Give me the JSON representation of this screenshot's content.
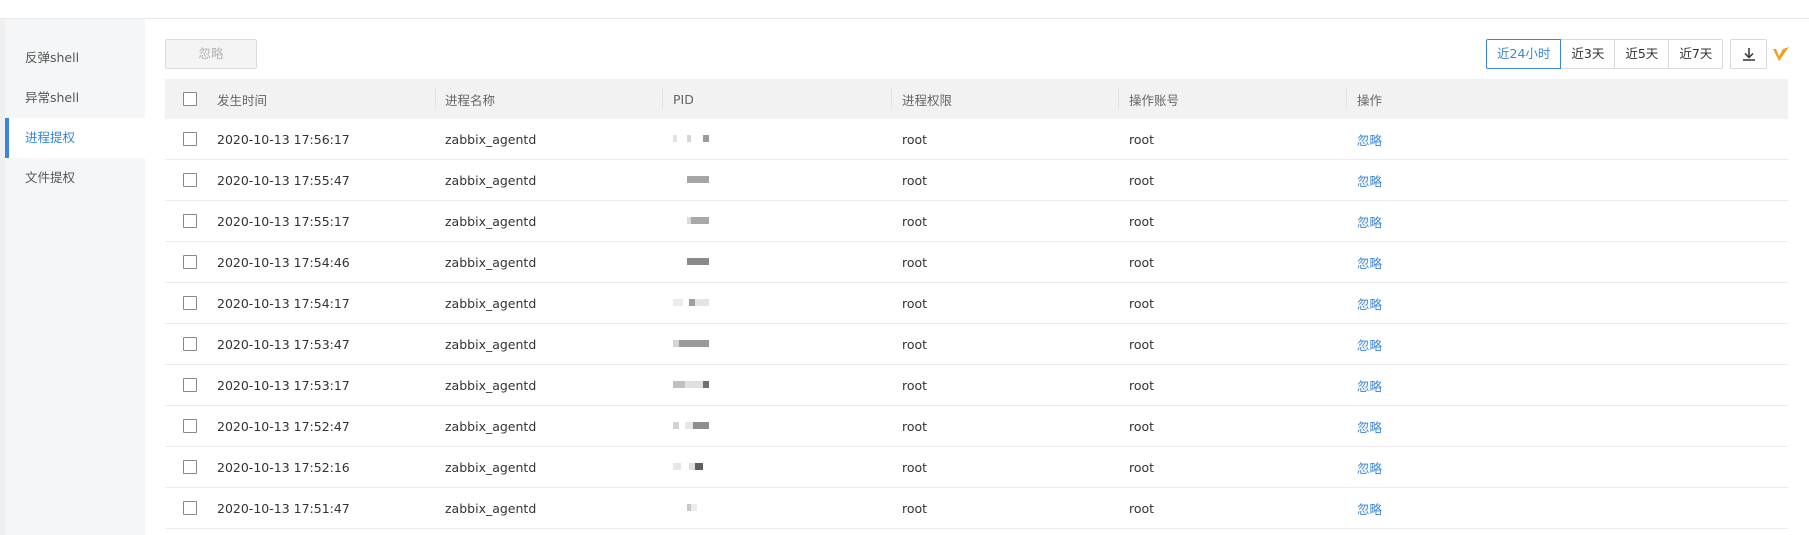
{
  "sidebar": {
    "items": [
      {
        "label": "反弹shell",
        "active": false
      },
      {
        "label": "异常shell",
        "active": false
      },
      {
        "label": "进程提权",
        "active": true
      },
      {
        "label": "文件提权",
        "active": false
      }
    ]
  },
  "toolbar": {
    "ignore_label": "忽略",
    "ranges": [
      {
        "label": "近24小时",
        "active": true
      },
      {
        "label": "近3天",
        "active": false
      },
      {
        "label": "近5天",
        "active": false
      },
      {
        "label": "近7天",
        "active": false
      }
    ],
    "download_icon": "download-icon",
    "brand_icon": "brand-logo-icon"
  },
  "table": {
    "headers": [
      "发生时间",
      "进程名称",
      "PID",
      "进程权限",
      "操作账号",
      "操作"
    ],
    "rows": [
      {
        "time": "2020-10-13 17:56:17",
        "process": "zabbix_agentd",
        "perm": "root",
        "account": "root",
        "action": "忽略"
      },
      {
        "time": "2020-10-13 17:55:47",
        "process": "zabbix_agentd",
        "perm": "root",
        "account": "root",
        "action": "忽略"
      },
      {
        "time": "2020-10-13 17:55:17",
        "process": "zabbix_agentd",
        "perm": "root",
        "account": "root",
        "action": "忽略"
      },
      {
        "time": "2020-10-13 17:54:46",
        "process": "zabbix_agentd",
        "perm": "root",
        "account": "root",
        "action": "忽略"
      },
      {
        "time": "2020-10-13 17:54:17",
        "process": "zabbix_agentd",
        "perm": "root",
        "account": "root",
        "action": "忽略"
      },
      {
        "time": "2020-10-13 17:53:47",
        "process": "zabbix_agentd",
        "perm": "root",
        "account": "root",
        "action": "忽略"
      },
      {
        "time": "2020-10-13 17:53:17",
        "process": "zabbix_agentd",
        "perm": "root",
        "account": "root",
        "action": "忽略"
      },
      {
        "time": "2020-10-13 17:52:47",
        "process": "zabbix_agentd",
        "perm": "root",
        "account": "root",
        "action": "忽略"
      },
      {
        "time": "2020-10-13 17:52:16",
        "process": "zabbix_agentd",
        "perm": "root",
        "account": "root",
        "action": "忽略"
      },
      {
        "time": "2020-10-13 17:51:47",
        "process": "zabbix_agentd",
        "perm": "root",
        "account": "root",
        "action": "忽略"
      }
    ]
  },
  "colors": {
    "accent": "#3a86d8",
    "brand": "#f0a11c"
  }
}
